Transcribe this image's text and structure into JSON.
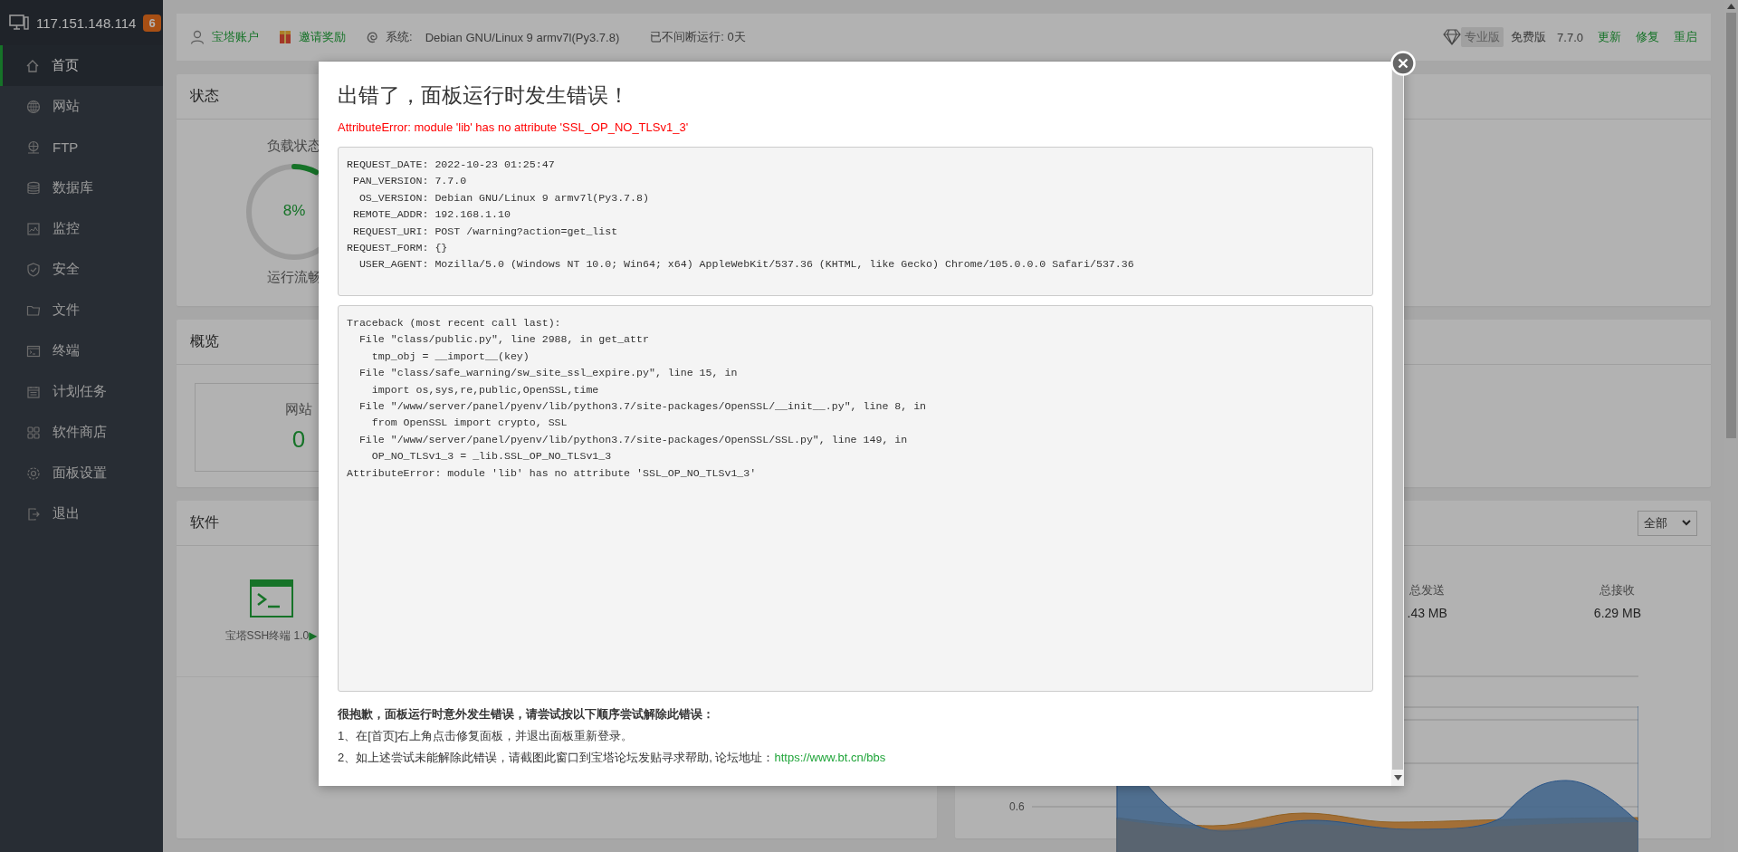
{
  "sidebar": {
    "host": "117.151.148.114",
    "badge": "6",
    "items": [
      {
        "label": "首页",
        "selected": true
      },
      {
        "label": "网站",
        "selected": false
      },
      {
        "label": "FTP",
        "selected": false
      },
      {
        "label": "数据库",
        "selected": false
      },
      {
        "label": "监控",
        "selected": false
      },
      {
        "label": "安全",
        "selected": false
      },
      {
        "label": "文件",
        "selected": false
      },
      {
        "label": "终端",
        "selected": false
      },
      {
        "label": "计划任务",
        "selected": false
      },
      {
        "label": "软件商店",
        "selected": false
      },
      {
        "label": "面板设置",
        "selected": false
      },
      {
        "label": "退出",
        "selected": false
      }
    ]
  },
  "topbar": {
    "account": "宝塔账户",
    "invite": "邀请奖励",
    "system_label": "系统:",
    "system": "Debian GNU/Linux 9 armv7l(Py3.7.8)",
    "uptime": "已不间断运行: 0天",
    "edition_badge": "专业版",
    "edition": "免费版",
    "version": "7.7.0",
    "links": [
      "更新",
      "修复",
      "重启"
    ]
  },
  "status": {
    "title": "状态",
    "gauges": [
      {
        "label": "负载状态",
        "value": "8%",
        "level": 0.08,
        "caption": "运行流畅"
      }
    ]
  },
  "overview": {
    "title": "概览",
    "cards": [
      {
        "label": "网站",
        "value": "0"
      }
    ]
  },
  "software": {
    "title": "软件",
    "items": [
      {
        "name": "宝塔SSH终端 1.0",
        "arrow": "▶"
      }
    ]
  },
  "traffic": {
    "filter": "全部",
    "stats": [
      {
        "label": "总发送",
        "value": ".43 MB"
      },
      {
        "label": "总接收",
        "value": "6.29 MB"
      }
    ],
    "y_label": "0.6"
  },
  "error_modal": {
    "title": "出错了，面板运行时发生错误！",
    "error": "AttributeError: module 'lib' has no attribute 'SSL_OP_NO_TLSv1_3'",
    "request_info": [
      "REQUEST_DATE: 2022-10-23 01:25:47",
      " PAN_VERSION: 7.7.0",
      "  OS_VERSION: Debian GNU/Linux 9 armv7l(Py3.7.8)",
      " REMOTE_ADDR: 192.168.1.10",
      " REQUEST_URI: POST /warning?action=get_list",
      "REQUEST_FORM: {}",
      "  USER_AGENT: Mozilla/5.0 (Windows NT 10.0; Win64; x64) AppleWebKit/537.36 (KHTML, like Gecko) Chrome/105.0.0.0 Safari/537.36"
    ],
    "traceback": [
      "Traceback (most recent call last):",
      "  File \"class/public.py\", line 2988, in get_attr",
      "    tmp_obj = __import__(key)",
      "  File \"class/safe_warning/sw_site_ssl_expire.py\", line 15, in",
      "    import os,sys,re,public,OpenSSL,time",
      "  File \"/www/server/panel/pyenv/lib/python3.7/site-packages/OpenSSL/__init__.py\", line 8, in",
      "    from OpenSSL import crypto, SSL",
      "  File \"/www/server/panel/pyenv/lib/python3.7/site-packages/OpenSSL/SSL.py\", line 149, in",
      "    OP_NO_TLSv1_3 = _lib.SSL_OP_NO_TLSv1_3",
      "AttributeError: module 'lib' has no attribute 'SSL_OP_NO_TLSv1_3'"
    ],
    "help_title": "很抱歉，面板运行时意外发生错误，请尝试按以下顺序尝试解除此错误：",
    "help_steps": [
      {
        "text": "1、在[首页]右上角点击修复面板，并退出面板重新登录。"
      },
      {
        "text": "2、如上述尝试未能解除此错误，请截图此窗口到宝塔论坛发贴寻求帮助, 论坛地址：",
        "link": "https://www.bt.cn/bbs"
      }
    ]
  }
}
